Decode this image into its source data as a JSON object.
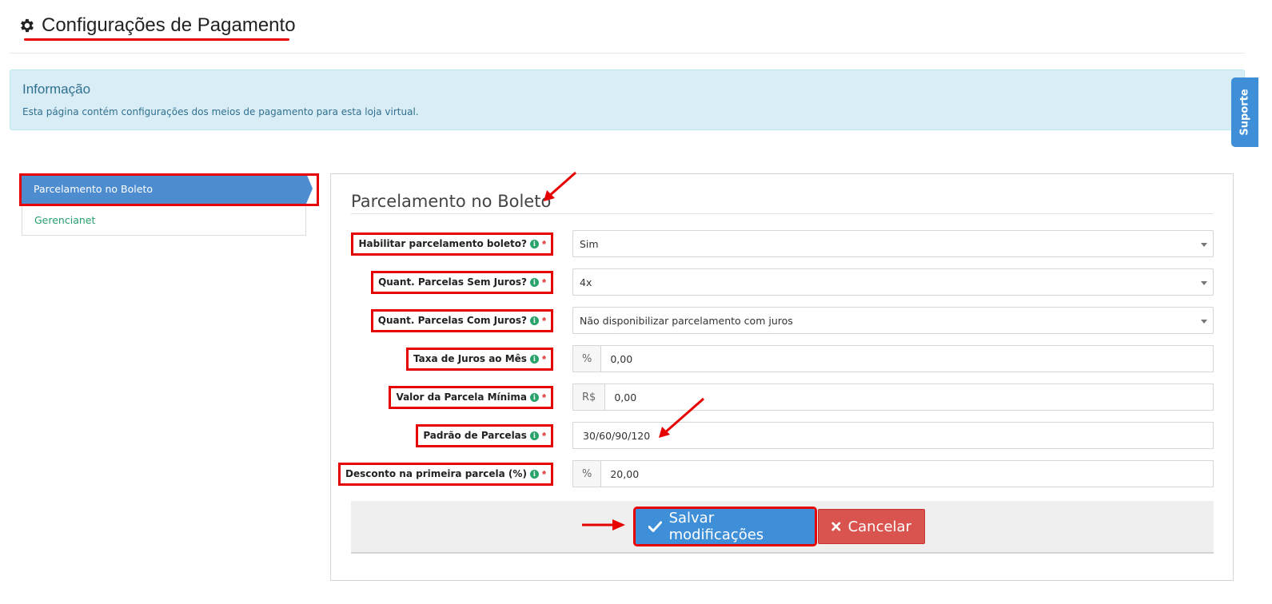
{
  "page": {
    "title": "Configurações de Pagamento",
    "icon": "gear-icon"
  },
  "info": {
    "heading": "Informação",
    "text": "Esta página contém configurações dos meios de pagamento para esta loja virtual."
  },
  "support_tab": {
    "label": "Suporte"
  },
  "sidebar": {
    "items": [
      {
        "label": "Parcelamento no Boleto",
        "active": true
      },
      {
        "label": "Gerencianet",
        "active": false
      }
    ]
  },
  "panel": {
    "title": "Parcelamento no Boleto"
  },
  "form": {
    "fields": [
      {
        "label": "Habilitar parcelamento boleto?",
        "value": "Sim",
        "type": "select"
      },
      {
        "label": "Quant. Parcelas Sem Juros?",
        "value": "4x",
        "type": "select"
      },
      {
        "label": "Quant. Parcelas Com Juros?",
        "value": "Não disponibilizar parcelamento com juros",
        "type": "select"
      },
      {
        "label": "Taxa de Juros ao Mês",
        "prefix": "%",
        "value": "0,00",
        "type": "addon"
      },
      {
        "label": "Valor da Parcela Mínima",
        "prefix": "R$",
        "value": "0,00",
        "type": "addon"
      },
      {
        "label": "Padrão de Parcelas",
        "value": "30/60/90/120",
        "type": "text"
      },
      {
        "label": "Desconto na primeira parcela (%)",
        "prefix": "%",
        "value": "20,00",
        "type": "addon"
      }
    ],
    "required_mark": "*",
    "info_glyph": "i"
  },
  "buttons": {
    "save": "Salvar modificações",
    "cancel": "Cancelar"
  },
  "colors": {
    "primary": "#3f8fd8",
    "danger": "#d9534f",
    "annotation": "#e60000",
    "info_bg": "#d9edf7",
    "link_green": "#27a06b"
  }
}
